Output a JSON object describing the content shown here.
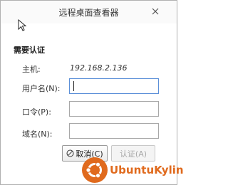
{
  "window": {
    "title": "远程桌面查看器",
    "close_icon": "close-icon"
  },
  "section": {
    "heading": "需要认证"
  },
  "host": {
    "label": "主机:",
    "value": "192.168.2.136"
  },
  "fields": {
    "username_label": "用户名(N):",
    "username_value": "",
    "password_label": "口令(P):",
    "password_value": "",
    "domain_label": "域名(N):",
    "domain_value": ""
  },
  "buttons": {
    "cancel_label": "取消(C)",
    "cancel_icon": "cancel-circle-icon",
    "ok_label": "认证(A)"
  },
  "watermark": {
    "text": "UbuntuKylin"
  },
  "colors": {
    "accent": "#e06a1d",
    "focus_border": "#5b8fd8",
    "disabled_text": "#a8a8a8"
  }
}
